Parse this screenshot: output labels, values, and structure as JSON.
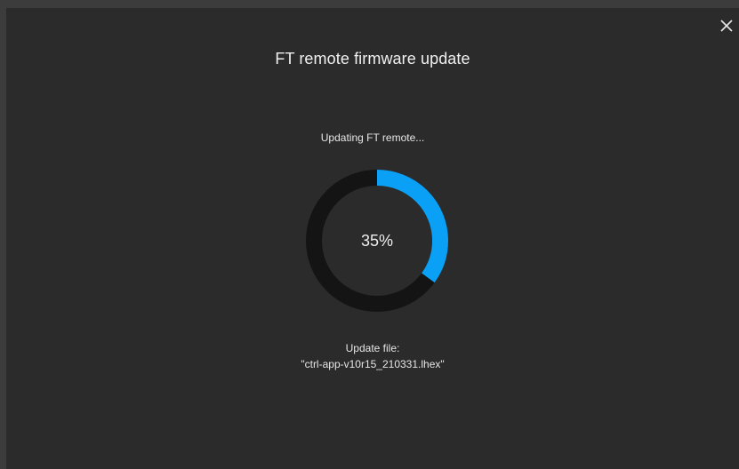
{
  "dialog": {
    "title": "FT remote firmware update",
    "status": "Updating FT remote...",
    "progress_percent": 35,
    "progress_label": "35%",
    "file_label": "Update file:",
    "file_name": "\"ctrl-app-v10r15_210331.lhex\"",
    "close_icon": "close-icon"
  },
  "colors": {
    "background": "#2b2b2b",
    "progress_track": "#141414",
    "progress_fill": "#0aa0f5",
    "text": "#e6e6e6"
  }
}
